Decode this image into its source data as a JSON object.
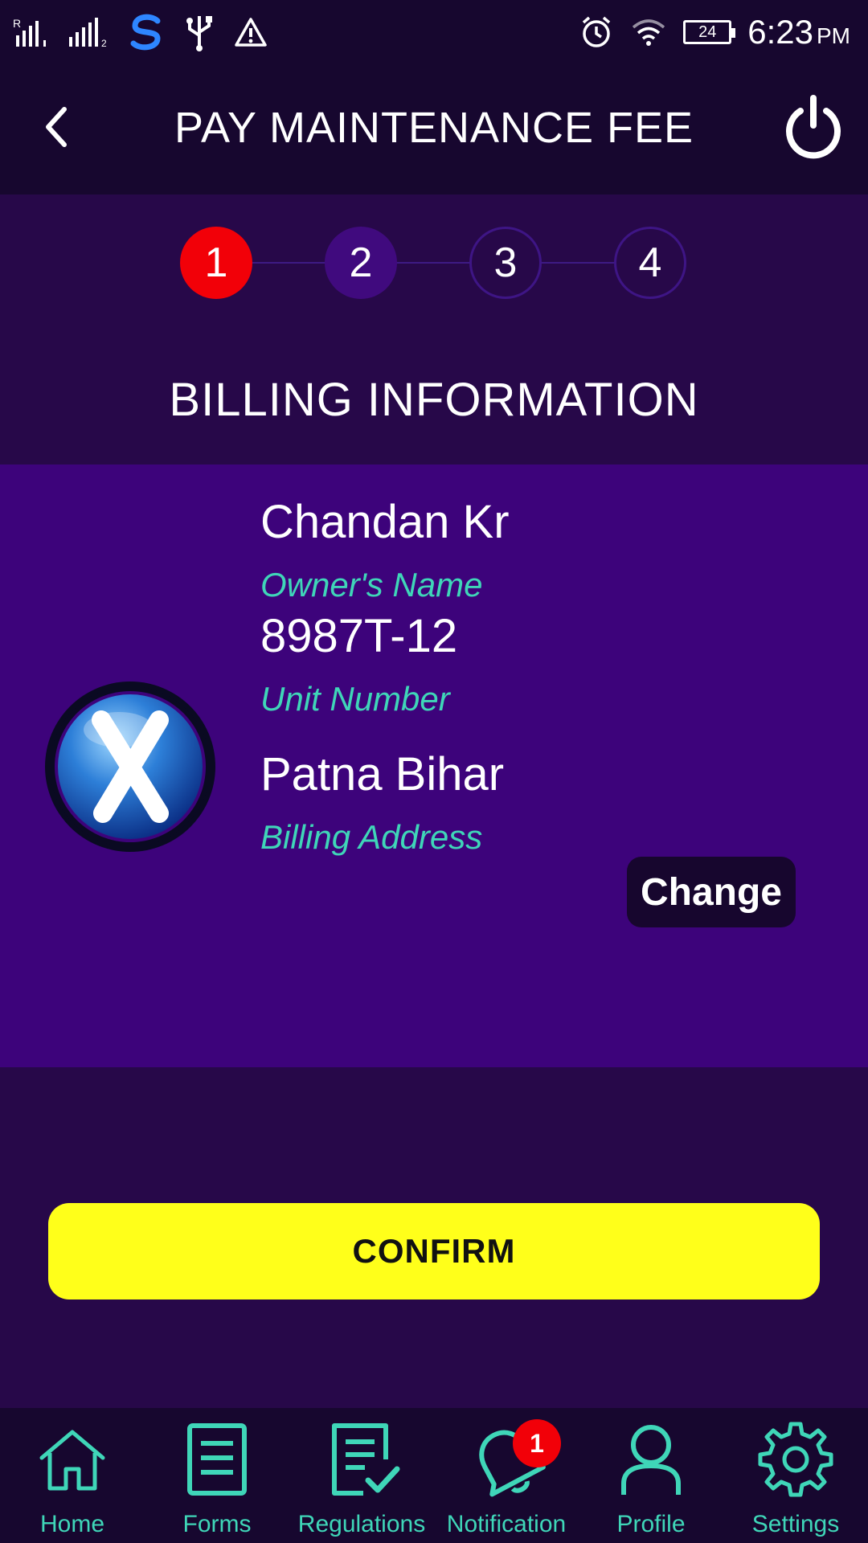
{
  "status_bar": {
    "time": "6:23",
    "ampm": "PM",
    "battery": "24",
    "left_icons": [
      "signal-r-icon",
      "signal-2-icon",
      "s-app-icon",
      "usb-icon",
      "warning-icon"
    ],
    "right_icons": [
      "alarm-icon",
      "wifi-icon",
      "battery-icon"
    ]
  },
  "header": {
    "title": "PAY MAINTENANCE FEE"
  },
  "stepper": {
    "steps": [
      "1",
      "2",
      "3",
      "4"
    ],
    "current_step": 1
  },
  "section": {
    "title": "BILLING INFORMATION"
  },
  "billing": {
    "owner_name": "Chandan Kr",
    "owner_label": "Owner's Name",
    "unit_number": "8987T-12",
    "unit_label": "Unit Number",
    "address": "Patna Bihar",
    "address_label": "Billing Address",
    "change_label": "Change"
  },
  "confirm_label": "CONFIRM",
  "bottom_nav": {
    "items": [
      {
        "label": "Home",
        "icon": "home-icon"
      },
      {
        "label": "Forms",
        "icon": "forms-icon"
      },
      {
        "label": "Regulations",
        "icon": "regulations-icon"
      },
      {
        "label": "Notification",
        "icon": "bell-icon",
        "badge": "1"
      },
      {
        "label": "Profile",
        "icon": "profile-icon"
      },
      {
        "label": "Settings",
        "icon": "gear-icon"
      }
    ]
  },
  "colors": {
    "accent_teal": "#3fd6b8",
    "confirm_yellow": "#ffff1a",
    "active_step_red": "#f20008",
    "card_purple": "#3d037b",
    "background_dark": "#17072f"
  }
}
